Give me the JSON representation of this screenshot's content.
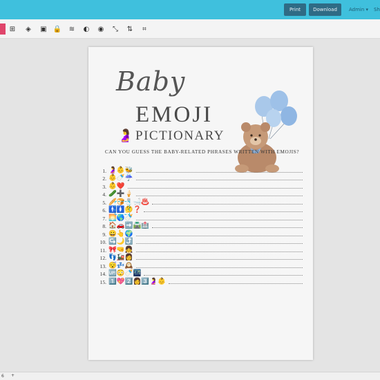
{
  "topbar": {
    "print_label": "Print",
    "download_label": "Download",
    "admin_label": "Admin ▾",
    "share_label": "Sh"
  },
  "toolbar": {
    "icons": [
      "add-page-icon",
      "layers-icon",
      "image-icon",
      "lock-icon",
      "stack-icon",
      "contrast-icon",
      "opacity-icon",
      "resize-icon",
      "adjust-icon",
      "crop-icon"
    ]
  },
  "page": {
    "title_line1": "Baby",
    "title_line2": "EMOJI",
    "title_line3": "PICTIONARY",
    "subtitle": "Can you guess the baby-related phrases written with emojis?",
    "rows": [
      {
        "num": "1.",
        "emojis": "🤰👶🐝"
      },
      {
        "num": "2.",
        "emojis": "👶🍼☔"
      },
      {
        "num": "3.",
        "emojis": "👶❤️"
      },
      {
        "num": "4.",
        "emojis": "🥒➕🍦"
      },
      {
        "num": "5.",
        "emojis": "🥖🍞🧂🛁♨️"
      },
      {
        "num": "6.",
        "emojis": "🚹🚺🤔❓"
      },
      {
        "num": "7.",
        "emojis": "🌅🌎🍼"
      },
      {
        "num": "8.",
        "emojis": "🏠🚗➡️🛣️🏥"
      },
      {
        "num": "9.",
        "emojis": "😀👆🌍"
      },
      {
        "num": "10.",
        "emojis": "↪️🌙⤴️"
      },
      {
        "num": "11.",
        "emojis": "🎀🤜👧"
      },
      {
        "num": "12.",
        "emojis": "👣🚂👩"
      },
      {
        "num": "13.",
        "emojis": "😴💤🕰️"
      },
      {
        "num": "14.",
        "emojis": "🆙😳🍼🌃"
      },
      {
        "num": "15.",
        "emojis": "1️⃣💖2️⃣👩3️⃣🤰👶"
      }
    ]
  },
  "statusbar": {
    "left_text": "6",
    "right_text": "+"
  }
}
